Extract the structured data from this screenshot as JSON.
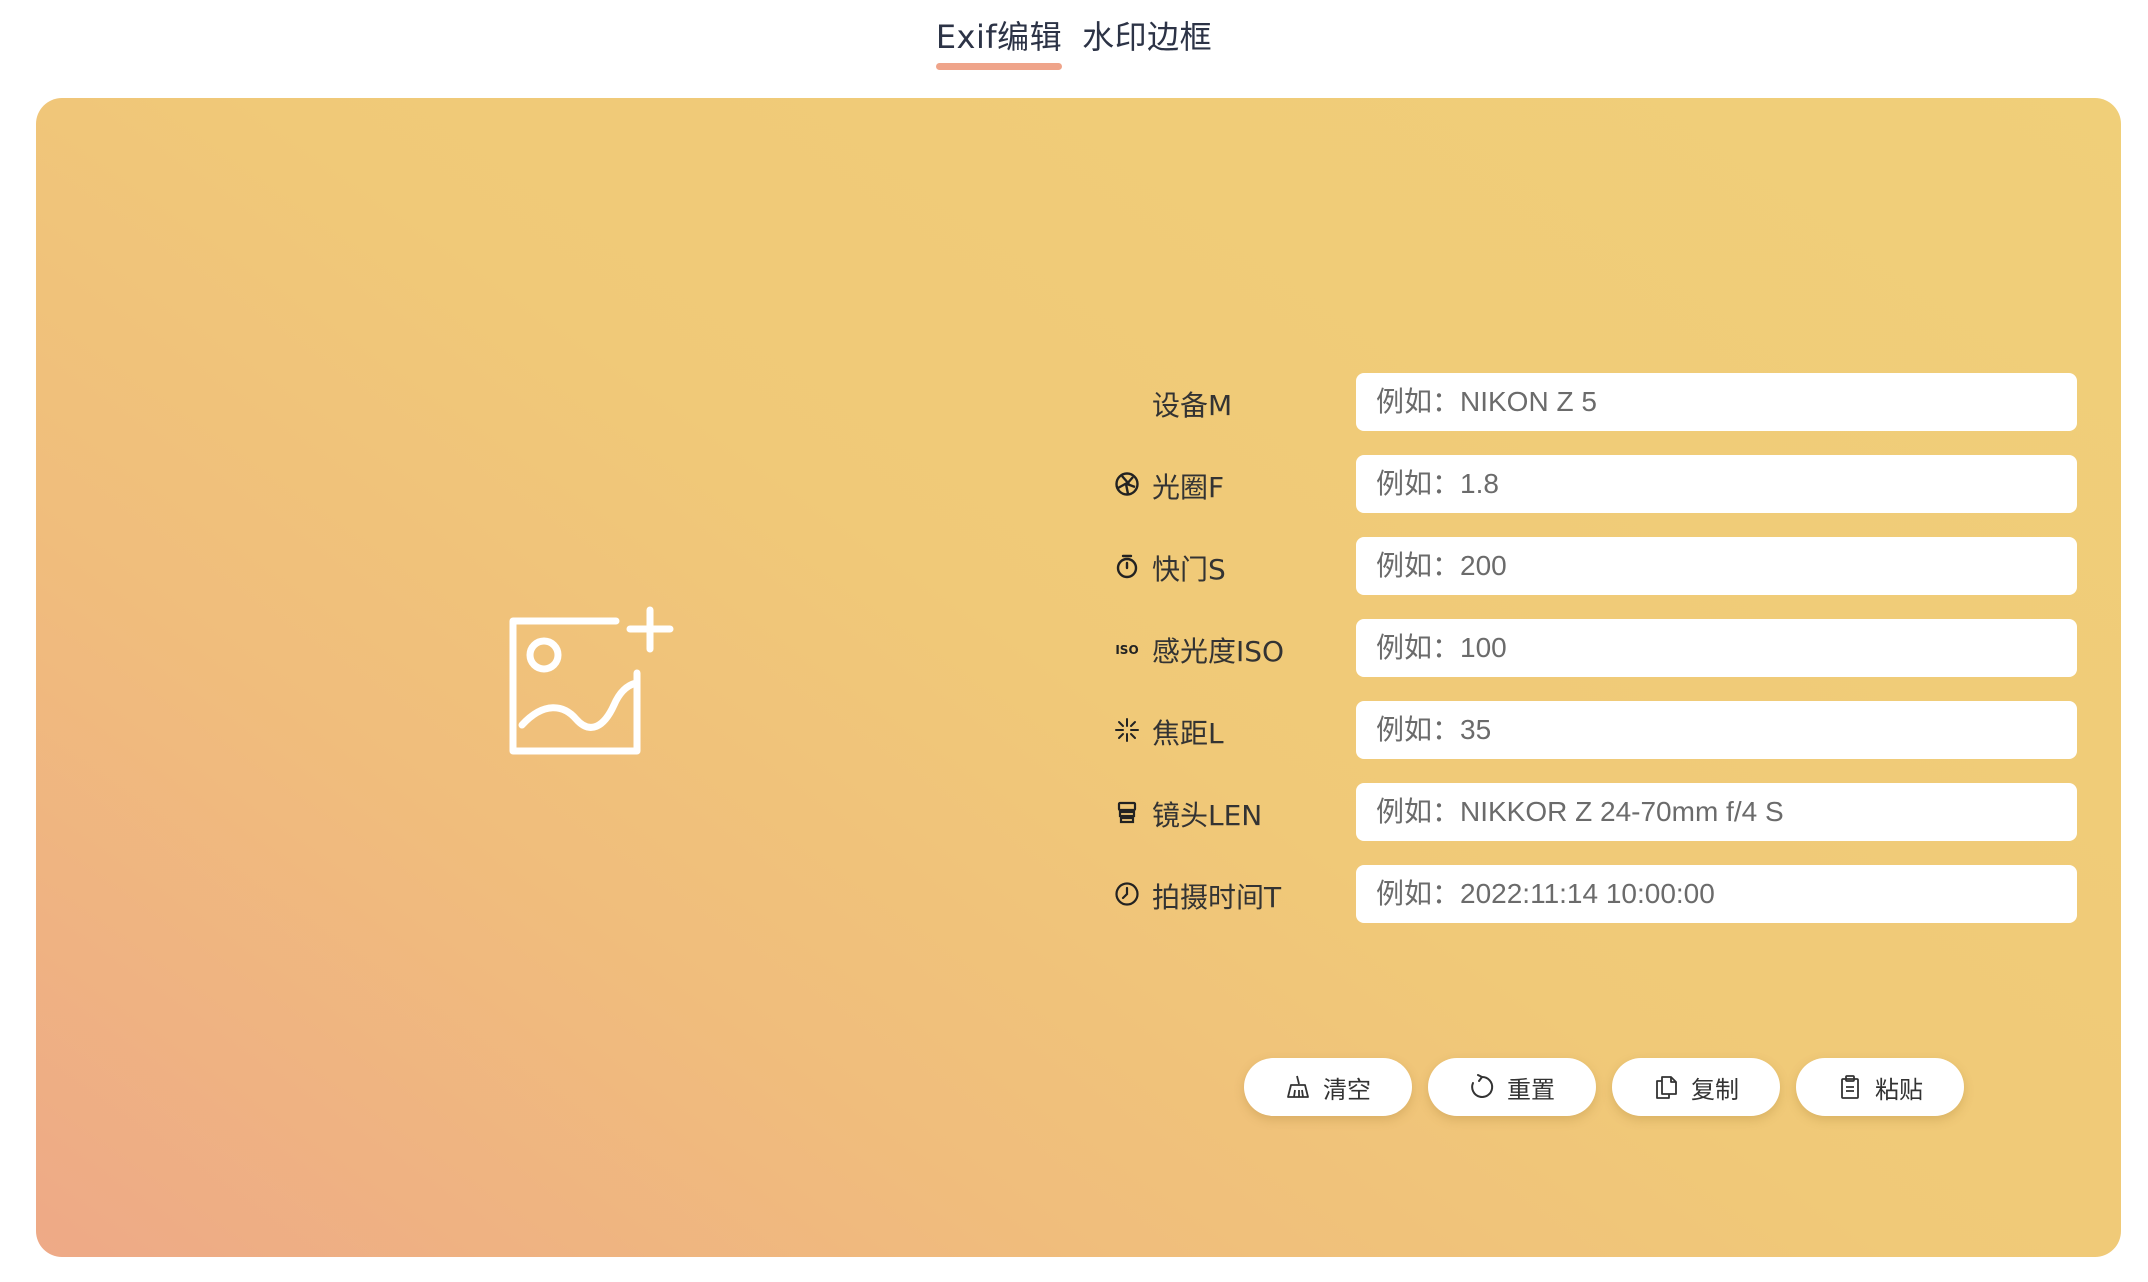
{
  "tabs": [
    {
      "label": "Exif编辑",
      "active": true
    },
    {
      "label": "水印边框",
      "active": false
    }
  ],
  "upload": {
    "icon": "add-image-icon"
  },
  "form": {
    "rows": [
      {
        "icon": "",
        "label": "设备M",
        "placeholder": "例如：NIKON Z 5",
        "value": ""
      },
      {
        "icon": "aperture-icon",
        "label": "光圈F",
        "placeholder": "例如：1.8",
        "value": ""
      },
      {
        "icon": "stopwatch-icon",
        "label": "快门S",
        "placeholder": "例如：200",
        "value": ""
      },
      {
        "icon": "iso-icon",
        "label": "感光度ISO",
        "placeholder": "例如：100",
        "value": ""
      },
      {
        "icon": "focus-icon",
        "label": "焦距L",
        "placeholder": "例如：35",
        "value": ""
      },
      {
        "icon": "lens-icon",
        "label": "镜头LEN",
        "placeholder": "例如：NIKKOR Z 24-70mm f/4 S",
        "value": ""
      },
      {
        "icon": "clock-icon",
        "label": "拍摄时间T",
        "placeholder": "例如：2022:11:14 10:00:00",
        "value": ""
      }
    ]
  },
  "actions": {
    "clear": {
      "label": "清空",
      "icon": "broom-icon"
    },
    "reset": {
      "label": "重置",
      "icon": "refresh-icon"
    },
    "copy": {
      "label": "复制",
      "icon": "copy-icon"
    },
    "paste": {
      "label": "粘贴",
      "icon": "clipboard-icon"
    }
  },
  "colors": {
    "tab_underline": "#efa48a",
    "panel_gradient_start": "#eea987",
    "panel_gradient_end": "#f0cf79"
  }
}
